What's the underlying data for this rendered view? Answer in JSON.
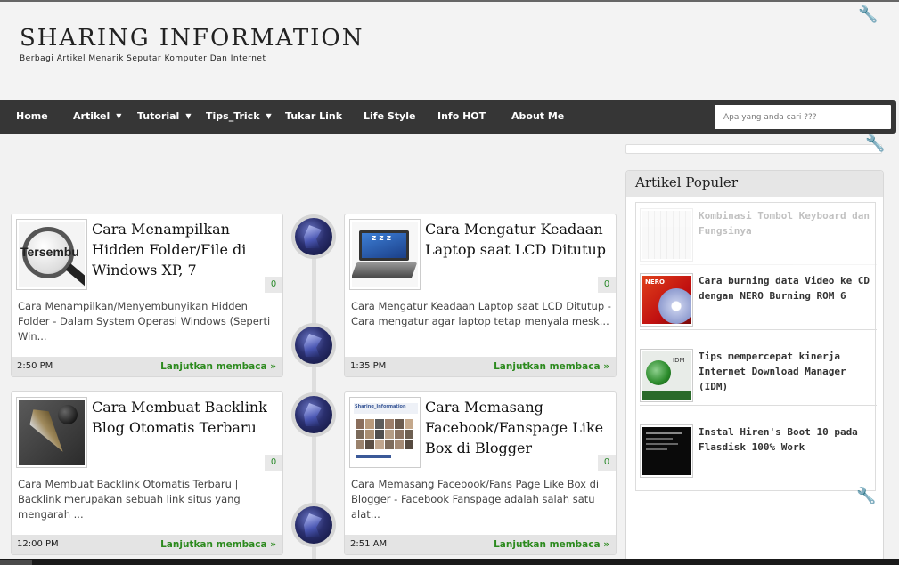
{
  "site": {
    "title": "SHARING INFORMATION",
    "description": "Berbagi Artikel Menarik Seputar Komputer Dan Internet"
  },
  "nav": {
    "items": [
      {
        "label": "Home",
        "has_dropdown": false
      },
      {
        "label": "Artikel",
        "has_dropdown": true
      },
      {
        "label": "Tutorial",
        "has_dropdown": true
      },
      {
        "label": "Tips_Trick",
        "has_dropdown": true
      },
      {
        "label": "Tukar Link",
        "has_dropdown": false
      },
      {
        "label": "Life Style",
        "has_dropdown": false
      },
      {
        "label": "Info HOT",
        "has_dropdown": false
      },
      {
        "label": "About Me",
        "has_dropdown": false
      }
    ],
    "caret_glyph": "▼",
    "search_placeholder": "Apa yang anda cari ???"
  },
  "posts": [
    {
      "title": "Cara Menampilkan Hidden Folder/File di Windows XP, 7",
      "comments": "0",
      "excerpt": "Cara Menampilkan/Menyembunyikan Hidden Folder - Dalam System Operasi Windows (Seperti Win...",
      "time": "2:50 PM",
      "read_more": "Lanjutkan membaca »",
      "thumb_icon": "magnifier-tersembunyi-icon",
      "thumb_text": "Tersembu"
    },
    {
      "title": "Cara Mengatur Keadaan Laptop saat LCD Ditutup",
      "comments": "0",
      "excerpt": "Cara Mengatur Keadaan Laptop saat LCD Ditutup  - Cara mengatur agar laptop tetap menyala mesk...",
      "time": "1:35 PM",
      "read_more": "Lanjutkan membaca »",
      "thumb_icon": "sleeping-laptop-icon",
      "thumb_text": "z z z"
    },
    {
      "title": "Cara Membuat Backlink Blog Otomatis Terbaru",
      "comments": "0",
      "excerpt": "Cara Membuat Backlink Otomatis Terbaru  |  Backlink merupakan sebuah link situs yang mengarah ...",
      "time": "12:00 PM",
      "read_more": "Lanjutkan membaca »",
      "thumb_icon": "pen-nib-icon"
    },
    {
      "title": "Cara Memasang Facebook/Fanspage Like Box di Blogger",
      "comments": "0",
      "excerpt": "Cara Memasang Facebook/Fans Page Like Box di Blogger  -  Facebook Fanspage adalah salah satu alat...",
      "time": "2:51 AM",
      "read_more": "Lanjutkan membaca »",
      "thumb_icon": "facebook-likebox-icon",
      "thumb_text": "Sharing_Information"
    }
  ],
  "sidebar": {
    "popular_title": "Artikel Populer",
    "popular": [
      {
        "title": "Kombinasi Tombol Keyboard dan Fungsinya",
        "icon": "keyboard-icon"
      },
      {
        "title": "Cara burning data Video ke CD dengan NERO Burning ROM 6",
        "icon": "nero-disc-icon",
        "thumb_text": "NERO"
      },
      {
        "title": "Tips mempercepat kinerja Internet Download Manager (IDM)",
        "icon": "idm-icon",
        "thumb_text": "IDM"
      },
      {
        "title": "Instal Hiren's Boot 10 pada Flasdisk 100% Work",
        "icon": "terminal-screen-icon"
      }
    ]
  },
  "colors": {
    "nav_bg": "#363636",
    "read_more": "#2c8a1e",
    "page_bg": "#f2f2f2"
  }
}
